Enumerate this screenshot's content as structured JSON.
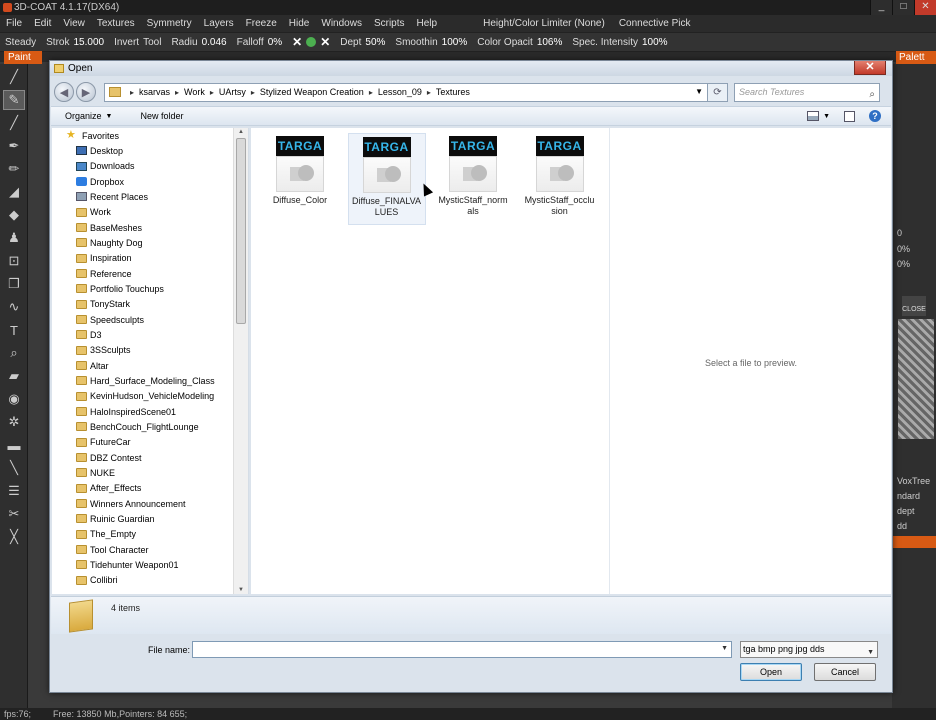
{
  "app": {
    "title": "3D-COAT 4.1.17(DX64)",
    "window_controls": [
      "_",
      "□",
      "✕"
    ],
    "menu": [
      "File",
      "Edit",
      "View",
      "Textures",
      "Symmetry",
      "Layers",
      "Freeze",
      "Hide",
      "Windows",
      "Scripts",
      "Help"
    ],
    "menu_right": [
      "Height/Color Limiter (None)",
      "Connective Pick"
    ],
    "toolbar": {
      "steady": "Steady",
      "stroke_label": "Strok",
      "stroke_value": "15.000",
      "invert": "Invert",
      "tool": "Tool",
      "radius_label": "Radiu",
      "radius_value": "0.046",
      "falloff_label": "Falloff",
      "falloff_value": "0%",
      "depth_label": "Dept",
      "depth_value": "50%",
      "smoothing_label": "Smoothin",
      "smoothing_value": "100%",
      "color_opacity_label": "Color Opacit",
      "color_opacity_value": "106%",
      "spec_label": "Spec. Intensity",
      "spec_value": "100%"
    },
    "paint_tab": "Paint",
    "palette_tab": "Palett",
    "right_panel": {
      "zero": "0",
      "pct1": "0%",
      "pct2": "0%",
      "close": "CLOSE",
      "voxtree": "VoxTree",
      "standard": "ndard",
      "depth": "dept",
      "add": "dd"
    },
    "statusbar": {
      "fps": "fps:76;",
      "memory": "Free: 13850 Mb,Pointers: 84  655;"
    }
  },
  "dialog": {
    "title": "Open",
    "breadcrumbs": [
      "ksarvas",
      "Work",
      "UArtsy",
      "Stylized Weapon Creation",
      "Lesson_09",
      "Textures"
    ],
    "search_placeholder": "Search Textures",
    "commands": {
      "organize": "Organize",
      "new_folder": "New folder"
    },
    "favorites_label": "Favorites",
    "nav_items": [
      {
        "label": "Desktop",
        "icon": "desktop"
      },
      {
        "label": "Downloads",
        "icon": "downloads"
      },
      {
        "label": "Dropbox",
        "icon": "dropbox"
      },
      {
        "label": "Recent Places",
        "icon": "recent"
      },
      {
        "label": "Work",
        "icon": "folder"
      },
      {
        "label": "BaseMeshes",
        "icon": "folder"
      },
      {
        "label": "Naughty Dog",
        "icon": "folder"
      },
      {
        "label": "Inspiration",
        "icon": "folder"
      },
      {
        "label": "Reference",
        "icon": "folder"
      },
      {
        "label": "Portfolio Touchups",
        "icon": "folder"
      },
      {
        "label": "TonyStark",
        "icon": "folder"
      },
      {
        "label": "Speedsculpts",
        "icon": "folder"
      },
      {
        "label": "D3",
        "icon": "folder"
      },
      {
        "label": "3SSculpts",
        "icon": "folder"
      },
      {
        "label": "Altar",
        "icon": "folder"
      },
      {
        "label": "Hard_Surface_Modeling_Class",
        "icon": "folder"
      },
      {
        "label": "KevinHudson_VehicleModeling",
        "icon": "folder"
      },
      {
        "label": "HaloInspiredScene01",
        "icon": "folder"
      },
      {
        "label": "BenchCouch_FlightLounge",
        "icon": "folder"
      },
      {
        "label": "FutureCar",
        "icon": "folder"
      },
      {
        "label": "DBZ Contest",
        "icon": "folder"
      },
      {
        "label": "NUKE",
        "icon": "folder"
      },
      {
        "label": "After_Effects",
        "icon": "folder"
      },
      {
        "label": "Winners Announcement",
        "icon": "folder"
      },
      {
        "label": "Ruinic Guardian",
        "icon": "folder"
      },
      {
        "label": "The_Empty",
        "icon": "folder"
      },
      {
        "label": "Tool Character",
        "icon": "folder"
      },
      {
        "label": "Tidehunter Weapon01",
        "icon": "folder"
      },
      {
        "label": "Collibri",
        "icon": "folder"
      }
    ],
    "files": [
      {
        "name": "Diffuse_Color",
        "badge": "TARGA",
        "selected": false
      },
      {
        "name": "Diffuse_FINALVALUES",
        "badge": "TARGA",
        "selected": true
      },
      {
        "name": "MysticStaff_normals",
        "badge": "TARGA",
        "selected": false
      },
      {
        "name": "MysticStaff_occlusion",
        "badge": "TARGA",
        "selected": false
      }
    ],
    "preview_message": "Select a file to preview.",
    "item_count": "4 items",
    "file_name_label": "File name:",
    "file_name_value": "",
    "file_type": "tga bmp png jpg dds",
    "open_label": "Open",
    "cancel_label": "Cancel"
  }
}
